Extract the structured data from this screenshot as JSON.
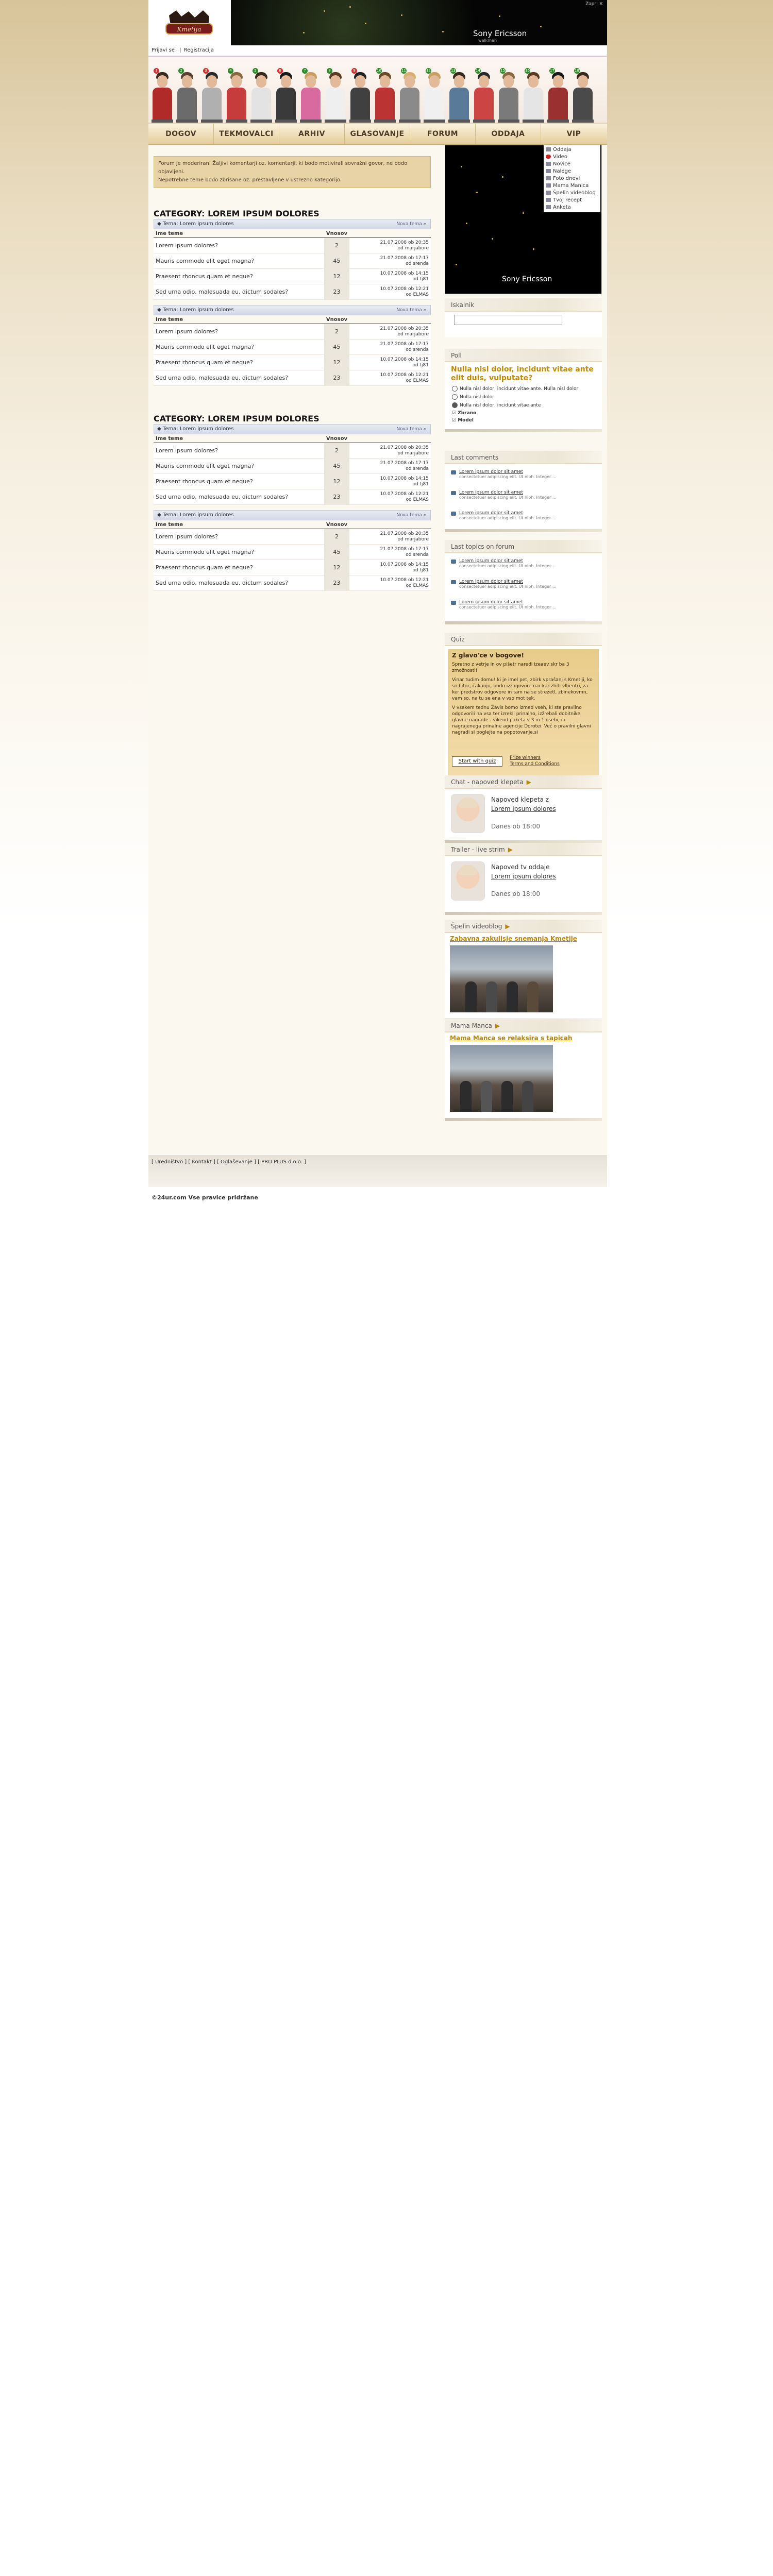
{
  "login": {
    "signin": "Prijavi se",
    "sep": "|",
    "register": "Registracija"
  },
  "banner": {
    "artist": "Sony Ericsson",
    "sub": "walkman",
    "close": "Zapri ✕"
  },
  "logo": {
    "text": "Kmetija"
  },
  "nav": [
    "DOGOV",
    "TEKMOVALCI",
    "ARHIV",
    "GLASOVANJE",
    "FORUM",
    "ODDAJA",
    "VIP"
  ],
  "notice": {
    "line1": "Forum je moderiran. Žaljivi komentarji oz. komentarji, ki bodo motivirali sovražni govor, ne bodo objavljeni.",
    "line2": "Nepotrebne teme bodo zbrisane oz. prestavljene v ustrezno kategorijo."
  },
  "table_headers": {
    "topic": "Ime teme",
    "count": "Vnosov",
    "last": ""
  },
  "categories": [
    {
      "title": "CATEGORY: LOREM IPSUM DOLORES",
      "forums": [
        {
          "title": "Tema: Lorem ipsum dolores",
          "new_label": "Nova tema",
          "rows": [
            {
              "topic": "Lorem ipsum dolores?",
              "count": "2",
              "date": "21.07.2008 ob 20:35",
              "by": "od marjabore"
            },
            {
              "topic": "Mauris commodo elit eget magna?",
              "count": "45",
              "date": "21.07.2008 ob 17:17",
              "by": "od srenda"
            },
            {
              "topic": "Praesent rhoncus quam et neque?",
              "count": "12",
              "date": "10.07.2008 ob 14:15",
              "by": "od tj81"
            },
            {
              "topic": "Sed urna odio, malesuada eu, dictum sodales?",
              "count": "23",
              "date": "10.07.2008 ob 12:21",
              "by": "od ELMAS"
            }
          ]
        },
        {
          "title": "Tema: Lorem ipsum dolores",
          "new_label": "Nova tema",
          "rows": [
            {
              "topic": "Lorem ipsum dolores?",
              "count": "2",
              "date": "21.07.2008 ob 20:35",
              "by": "od marjabore"
            },
            {
              "topic": "Mauris commodo elit eget magna?",
              "count": "45",
              "date": "21.07.2008 ob 17:17",
              "by": "od srenda"
            },
            {
              "topic": "Praesent rhoncus quam et neque?",
              "count": "12",
              "date": "10.07.2008 ob 14:15",
              "by": "od tj81"
            },
            {
              "topic": "Sed urna odio, malesuada eu, dictum sodales?",
              "count": "23",
              "date": "10.07.2008 ob 12:21",
              "by": "od ELMAS"
            }
          ]
        }
      ]
    },
    {
      "title": "CATEGORY: LOREM IPSUM DOLORES",
      "forums": [
        {
          "title": "Tema: Lorem ipsum dolores",
          "new_label": "Nova tema",
          "rows": [
            {
              "topic": "Lorem ipsum dolores?",
              "count": "2",
              "date": "21.07.2008 ob 20:35",
              "by": "od marjabore"
            },
            {
              "topic": "Mauris commodo elit eget magna?",
              "count": "45",
              "date": "21.07.2008 ob 17:17",
              "by": "od srenda"
            },
            {
              "topic": "Praesent rhoncus quam et neque?",
              "count": "12",
              "date": "10.07.2008 ob 14:15",
              "by": "od tj81"
            },
            {
              "topic": "Sed urna odio, malesuada eu, dictum sodales?",
              "count": "23",
              "date": "10.07.2008 ob 12:21",
              "by": "od ELMAS"
            }
          ]
        },
        {
          "title": "Tema: Lorem ipsum dolores",
          "new_label": "Nova tema",
          "rows": [
            {
              "topic": "Lorem ipsum dolores?",
              "count": "2",
              "date": "21.07.2008 ob 20:35",
              "by": "od marjabore"
            },
            {
              "topic": "Mauris commodo elit eget magna?",
              "count": "45",
              "date": "21.07.2008 ob 17:17",
              "by": "od srenda"
            },
            {
              "topic": "Praesent rhoncus quam et neque?",
              "count": "12",
              "date": "10.07.2008 ob 14:15",
              "by": "od tj81"
            },
            {
              "topic": "Sed urna odio, malesuada eu, dictum sodales?",
              "count": "23",
              "date": "10.07.2008 ob 12:21",
              "by": "od ELMAS"
            }
          ]
        }
      ]
    }
  ],
  "video": {
    "artist": "Sony Ericsson",
    "menu": [
      "Oddaja",
      "Video",
      "Novice",
      "Nalege",
      "Foto dnevi",
      "Mama Manica",
      "Špelin videoblog",
      "Tvoj recept",
      "Anketa"
    ]
  },
  "search": {
    "title": "Iskalnik"
  },
  "poll": {
    "title": "Poll",
    "question": "Nulla nisl dolor, incidunt vitae ante elit duis, vulputate?",
    "options": [
      "Nulla nisl dolor, incidunt vitae ante. Nulla nisl dolor",
      "Nulla nisl dolor",
      "Nulla nisl dolor, incidunt vitae ante"
    ],
    "results": "Zbrano",
    "vote": "Model"
  },
  "last_comments": {
    "title": "Last comments",
    "items": [
      {
        "title": "Lorem ipsum dolor sit amet",
        "desc": "consectetuer adipiscing elit. Ut nibh. Integer ..."
      },
      {
        "title": "Lorem ipsum dolor sit amet",
        "desc": "consectetuer adipiscing elit. Ut nibh. Integer ..."
      },
      {
        "title": "Lorem ipsum dolor sit amet",
        "desc": "consectetuer adipiscing elit. Ut nibh. Integer ..."
      }
    ]
  },
  "last_topics": {
    "title": "Last topics on forum",
    "items": [
      {
        "title": "Lorem ipsum dolor sit amet",
        "desc": "consectetuer adipiscing elit. Ut nibh. Integer ..."
      },
      {
        "title": "Lorem ipsum dolor sit amet",
        "desc": "consectetuer adipiscing elit. Ut nibh. Integer ..."
      },
      {
        "title": "Lorem ipsum dolor sit amet",
        "desc": "consectetuer adipiscing elit. Ut nibh. Integer ..."
      }
    ]
  },
  "quiz": {
    "title": "Quiz",
    "heading": "Z glavo'ce v bogove!",
    "p1": "Spretno z vetrje in ov pišetr naredi izeaev skr ba 3 zmožnosti!",
    "p2": "Vinar tudim domu! ki je imel pet, zbirk vprašanj s Kmetiji, ko so bitor, čakanju, bodo izzagovore nar kar zbiti vlhentri, za ker predstrov odgovore in tam na se strezetl, zbinekovmn, vam so, na tu se ena v vso mot tek.",
    "p3": "V vsakem tednu Žavis bomo izmed vseh, ki ste pravilno odgovorili na vsa ter izrekli prinalno, izžrebali dobitnike glavne nagrade - vikend paketa v 3 in 1 osebi, in nagrajenega prinalne agencije Dorotei. Več o pravilni glavni nagradi si poglejte na popotovanje.si",
    "start": "Start with quiz",
    "links": [
      "Prize winners",
      "Terms and Conditions"
    ]
  },
  "chat": {
    "title": "Chat - napoved klepeta",
    "label": "Napoved klepeta z",
    "name": "Lorem ipsum dolores",
    "time": "Danes ob 18:00"
  },
  "trailer": {
    "title": "Trailer - live strim",
    "label": "Napoved tv oddaje",
    "name": "Lorem ipsum dolores",
    "time": "Danes ob 18:00"
  },
  "videoblog": {
    "title": "Špelin videoblog",
    "link": "Zabavna zakulisje snemanja Kmetije"
  },
  "mama": {
    "title": "Mama Manca",
    "link": "Mama Manca se relaksira s tapicah"
  },
  "footer": {
    "links": "[ Uredništvo ]  [ Kontakt ] [ Oglaševanje ] [ PRO PLUS d.o.o. ]",
    "copy": "©24ur.com Vse pravice pridržane"
  },
  "colors": {
    "accent": "#c08a00",
    "nav_bg": "#e4cc9a",
    "notice_bg": "#e8d3a6"
  }
}
